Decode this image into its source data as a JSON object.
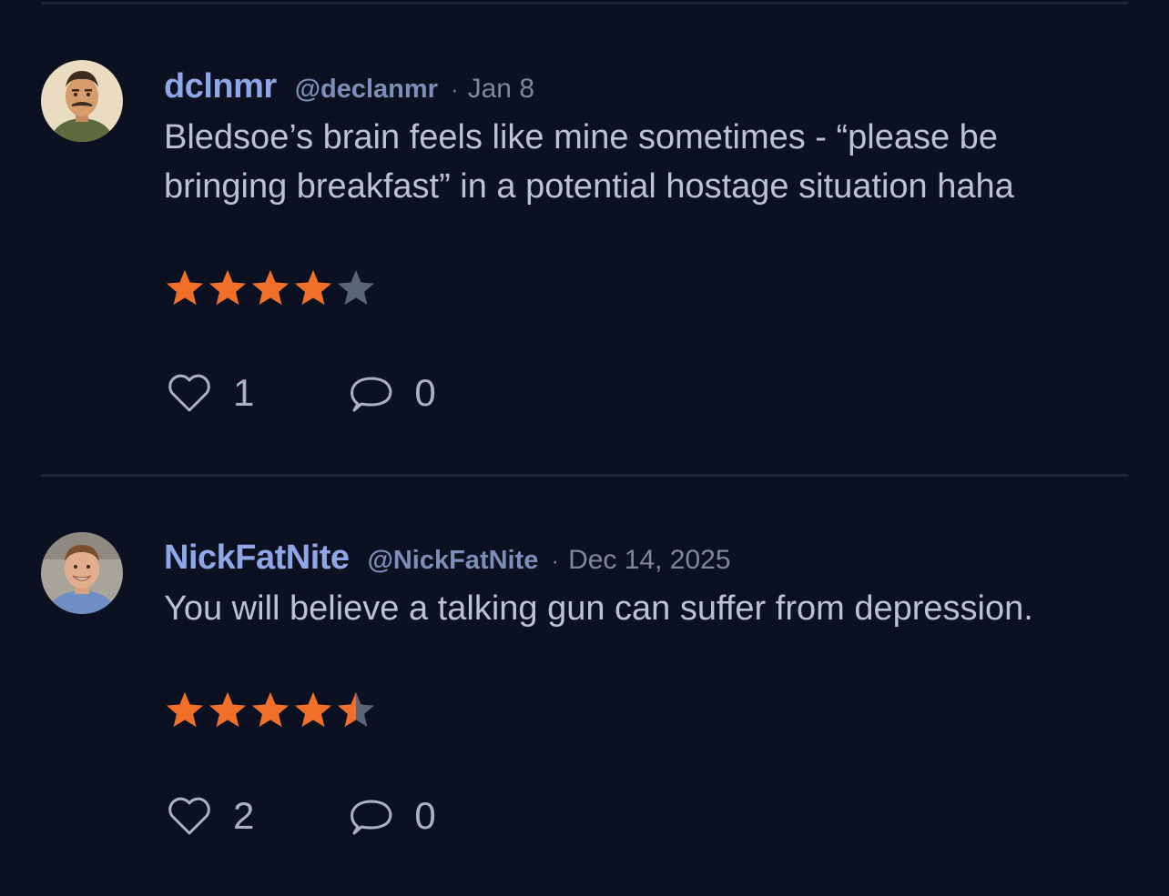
{
  "reviews": [
    {
      "name": "dclnmr",
      "handle": "@declanmr",
      "separator": "·",
      "date": "Jan 8",
      "text": "Bledsoe’s brain feels like mine sometimes - “please be bringing breakfast” in a potential hostage situation haha",
      "rating": 4,
      "likes": "1",
      "comments": "0"
    },
    {
      "name": "NickFatNite",
      "handle": "@NickFatNite",
      "separator": "·",
      "date": "Dec 14, 2025",
      "text": "You will believe a talking gun can suffer from depression.",
      "rating": 4.5,
      "likes": "2",
      "comments": "0"
    }
  ],
  "colors": {
    "background": "#0b1120",
    "star_filled": "#f26f2a",
    "star_empty": "#5a6578",
    "name": "#8fa7e6"
  },
  "icons": [
    "heart-icon",
    "comment-icon",
    "star-icon"
  ]
}
